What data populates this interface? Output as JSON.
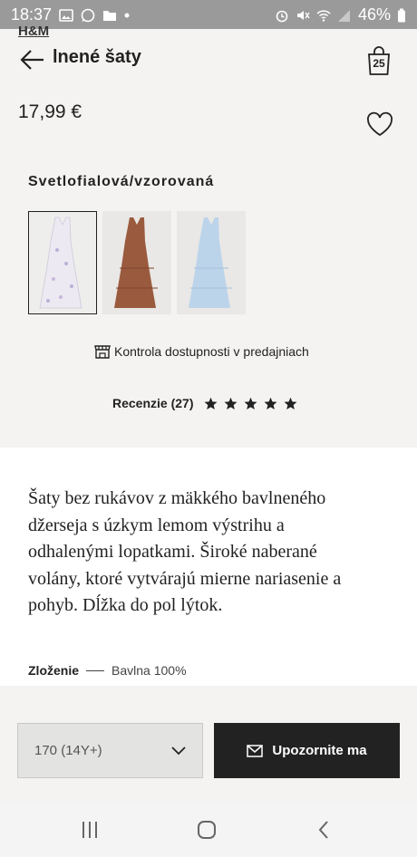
{
  "status_bar": {
    "time": "18:37",
    "battery": "46%",
    "left_icons": [
      "image-icon",
      "whatsapp-icon",
      "folder-icon",
      "dot-icon"
    ],
    "right_icons": [
      "alarm-icon",
      "mute-icon",
      "wifi-icon",
      "signal-icon",
      "battery-icon"
    ]
  },
  "header": {
    "logo": "H&M",
    "title": "lnené šaty",
    "bag_count": "25"
  },
  "product": {
    "price": "17,99 €",
    "color_name": "Svetlofialová/vzorovaná",
    "swatches": [
      {
        "name": "Light lilac patterned",
        "color": "#e8e6ee",
        "selected": true
      },
      {
        "name": "Brown",
        "color": "#9a5a3e",
        "selected": false
      },
      {
        "name": "Light blue",
        "color": "#bcd4ea",
        "selected": false
      }
    ],
    "stock_check_label": "Kontrola dostupnosti v predajniach",
    "reviews_label": "Recenzie (27)",
    "rating": 5,
    "rating_max": 5
  },
  "description": {
    "text": "Šaty bez rukávov z mäkkého bavlneného džerseja s úzkym lemom výstrihu a odhalenými lopatkami. Široké naberané volány, ktoré vytvárajú mierne nariasenie a pohyb. Dĺžka do pol lýtok.",
    "composition_label": "Zloženie",
    "composition_value": "Bavlna 100%"
  },
  "actions": {
    "size_value": "170 (14Y+)",
    "notify_label": "Upozornite ma"
  },
  "nav": {
    "icons": [
      "recent-apps-icon",
      "home-icon",
      "back-icon"
    ]
  },
  "colors": {
    "accent": "#222222",
    "panel_bg": "#f4f3f1",
    "status_bar_bg": "#9a9a9a"
  }
}
